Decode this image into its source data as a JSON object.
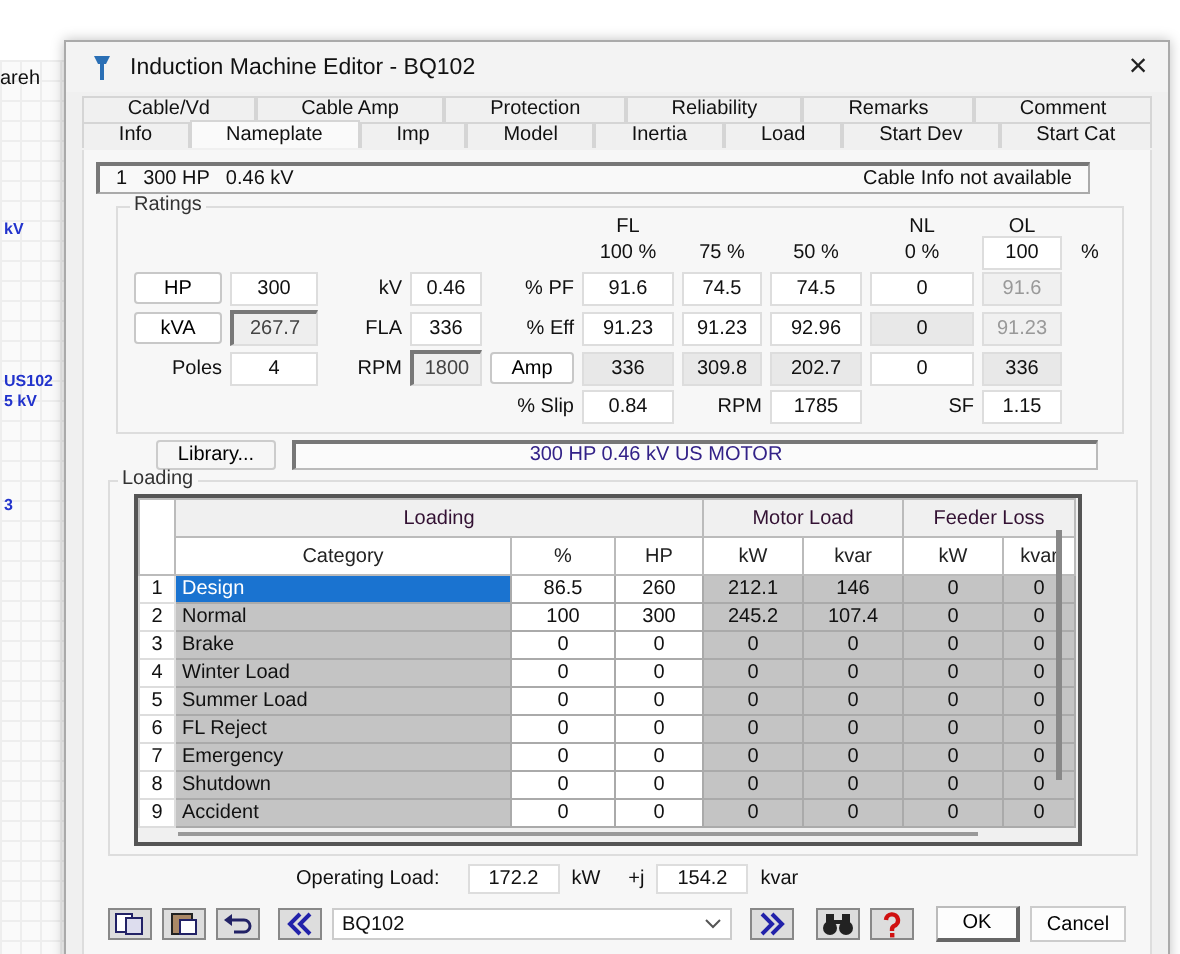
{
  "background": {
    "texts": [
      "areh",
      "kV",
      "US102",
      "5 kV",
      "3"
    ]
  },
  "window": {
    "title": "Induction Machine Editor - BQ102",
    "close": "×"
  },
  "tabs": [
    [
      {
        "label": "Cable/Vd",
        "selected": false
      },
      {
        "label": "Cable Amp",
        "selected": false
      },
      {
        "label": "Protection",
        "selected": false
      },
      {
        "label": "Reliability",
        "selected": false
      },
      {
        "label": "Remarks",
        "selected": false
      },
      {
        "label": "Comment",
        "selected": false
      }
    ],
    [
      {
        "label": "Info",
        "selected": false
      },
      {
        "label": "Nameplate",
        "selected": true
      },
      {
        "label": "Imp",
        "selected": false
      },
      {
        "label": "Model",
        "selected": false
      },
      {
        "label": "Inertia",
        "selected": false
      },
      {
        "label": "Load",
        "selected": false
      },
      {
        "label": "Start Dev",
        "selected": false
      },
      {
        "label": "Start Cat",
        "selected": false
      }
    ]
  ],
  "info": {
    "id": "1",
    "rating": "300 HP",
    "voltage": "0.46 kV",
    "cable": "Cable Info not available"
  },
  "ratings": {
    "title": "Ratings",
    "rows": [
      [
        {
          "kind": "gap"
        },
        {
          "kind": "gap"
        },
        {
          "kind": "gap"
        },
        {
          "kind": "gap"
        },
        {
          "kind": "gap"
        },
        {
          "kind": "label",
          "text": "FL"
        },
        {
          "kind": "gap"
        },
        {
          "kind": "gap"
        },
        {
          "kind": "label",
          "text": "NL"
        },
        {
          "kind": "label",
          "text": "OL"
        },
        {
          "kind": "gap"
        }
      ],
      [
        {
          "kind": "gap"
        },
        {
          "kind": "gap"
        },
        {
          "kind": "gap"
        },
        {
          "kind": "gap"
        },
        {
          "kind": "gap"
        },
        {
          "kind": "label",
          "text": "100 %"
        },
        {
          "kind": "label",
          "text": "75 %"
        },
        {
          "kind": "label",
          "text": "50 %"
        },
        {
          "kind": "label",
          "text": "0 %"
        },
        {
          "kind": "input",
          "text": "100"
        },
        {
          "kind": "label",
          "text": "%"
        }
      ],
      [
        {
          "kind": "button",
          "text": "HP"
        },
        {
          "kind": "input",
          "text": "300"
        },
        {
          "kind": "label",
          "text": "kV"
        },
        {
          "kind": "input",
          "text": "0.46"
        },
        {
          "kind": "label",
          "text": "% PF"
        },
        {
          "kind": "input",
          "text": "91.6"
        },
        {
          "kind": "input",
          "text": "74.5"
        },
        {
          "kind": "input",
          "text": "74.5"
        },
        {
          "kind": "input",
          "text": "0"
        },
        {
          "kind": "dim",
          "text": "91.6"
        },
        {
          "kind": "gap"
        }
      ],
      [
        {
          "kind": "button",
          "text": "kVA"
        },
        {
          "kind": "sunken",
          "text": "267.7"
        },
        {
          "kind": "label",
          "text": "FLA"
        },
        {
          "kind": "input",
          "text": "336"
        },
        {
          "kind": "label",
          "text": "% Eff"
        },
        {
          "kind": "input",
          "text": "91.23"
        },
        {
          "kind": "input",
          "text": "91.23"
        },
        {
          "kind": "input",
          "text": "92.96"
        },
        {
          "kind": "readonly",
          "text": "0"
        },
        {
          "kind": "dim",
          "text": "91.23"
        },
        {
          "kind": "gap"
        }
      ],
      [
        {
          "kind": "label",
          "text": "Poles"
        },
        {
          "kind": "input",
          "text": "4"
        },
        {
          "kind": "label",
          "text": "RPM"
        },
        {
          "kind": "sunken",
          "text": "1800"
        },
        {
          "kind": "button",
          "text": "Amp"
        },
        {
          "kind": "readonly",
          "text": "336"
        },
        {
          "kind": "readonly",
          "text": "309.8"
        },
        {
          "kind": "readonly",
          "text": "202.7"
        },
        {
          "kind": "input",
          "text": "0"
        },
        {
          "kind": "readonly",
          "text": "336"
        },
        {
          "kind": "gap"
        }
      ],
      [
        {
          "kind": "gap"
        },
        {
          "kind": "gap"
        },
        {
          "kind": "gap"
        },
        {
          "kind": "gap"
        },
        {
          "kind": "label",
          "text": "% Slip"
        },
        {
          "kind": "input",
          "text": "0.84"
        },
        {
          "kind": "label",
          "text": "RPM"
        },
        {
          "kind": "input",
          "text": "1785"
        },
        {
          "kind": "label",
          "text": "SF"
        },
        {
          "kind": "input",
          "text": "1.15"
        },
        {
          "kind": "gap"
        }
      ]
    ]
  },
  "library": {
    "button": "Library...",
    "description": "300 HP  0.46 kV  US MOTOR"
  },
  "loading": {
    "title": "Loading",
    "groups": [
      "Loading",
      "Motor Load",
      "Feeder Loss"
    ],
    "columns": [
      "Category",
      "%",
      "HP",
      "kW",
      "kvar",
      "kW",
      "kvar"
    ],
    "rows": [
      {
        "index": "1",
        "category": "Design",
        "percent": "86.5",
        "hp": "260",
        "motor_kw": "212.1",
        "motor_kvar": "146",
        "feeder_kw": "0",
        "feeder_kvar": "0",
        "selected": true
      },
      {
        "index": "2",
        "category": "Normal",
        "percent": "100",
        "hp": "300",
        "motor_kw": "245.2",
        "motor_kvar": "107.4",
        "feeder_kw": "0",
        "feeder_kvar": "0",
        "selected": false
      },
      {
        "index": "3",
        "category": "Brake",
        "percent": "0",
        "hp": "0",
        "motor_kw": "0",
        "motor_kvar": "0",
        "feeder_kw": "0",
        "feeder_kvar": "0",
        "selected": false
      },
      {
        "index": "4",
        "category": "Winter Load",
        "percent": "0",
        "hp": "0",
        "motor_kw": "0",
        "motor_kvar": "0",
        "feeder_kw": "0",
        "feeder_kvar": "0",
        "selected": false
      },
      {
        "index": "5",
        "category": "Summer Load",
        "percent": "0",
        "hp": "0",
        "motor_kw": "0",
        "motor_kvar": "0",
        "feeder_kw": "0",
        "feeder_kvar": "0",
        "selected": false
      },
      {
        "index": "6",
        "category": "FL Reject",
        "percent": "0",
        "hp": "0",
        "motor_kw": "0",
        "motor_kvar": "0",
        "feeder_kw": "0",
        "feeder_kvar": "0",
        "selected": false
      },
      {
        "index": "7",
        "category": "Emergency",
        "percent": "0",
        "hp": "0",
        "motor_kw": "0",
        "motor_kvar": "0",
        "feeder_kw": "0",
        "feeder_kvar": "0",
        "selected": false
      },
      {
        "index": "8",
        "category": "Shutdown",
        "percent": "0",
        "hp": "0",
        "motor_kw": "0",
        "motor_kvar": "0",
        "feeder_kw": "0",
        "feeder_kvar": "0",
        "selected": false
      },
      {
        "index": "9",
        "category": "Accident",
        "percent": "0",
        "hp": "0",
        "motor_kw": "0",
        "motor_kvar": "0",
        "feeder_kw": "0",
        "feeder_kvar": "0",
        "selected": false
      }
    ]
  },
  "operating_load": {
    "label": "Operating Load:",
    "kw": "172.2",
    "kw_unit": "kW",
    "j": "+j",
    "kvar": "154.2",
    "kvar_unit": "kvar"
  },
  "footer": {
    "element": "BQ102",
    "ok": "OK",
    "cancel": "Cancel"
  }
}
